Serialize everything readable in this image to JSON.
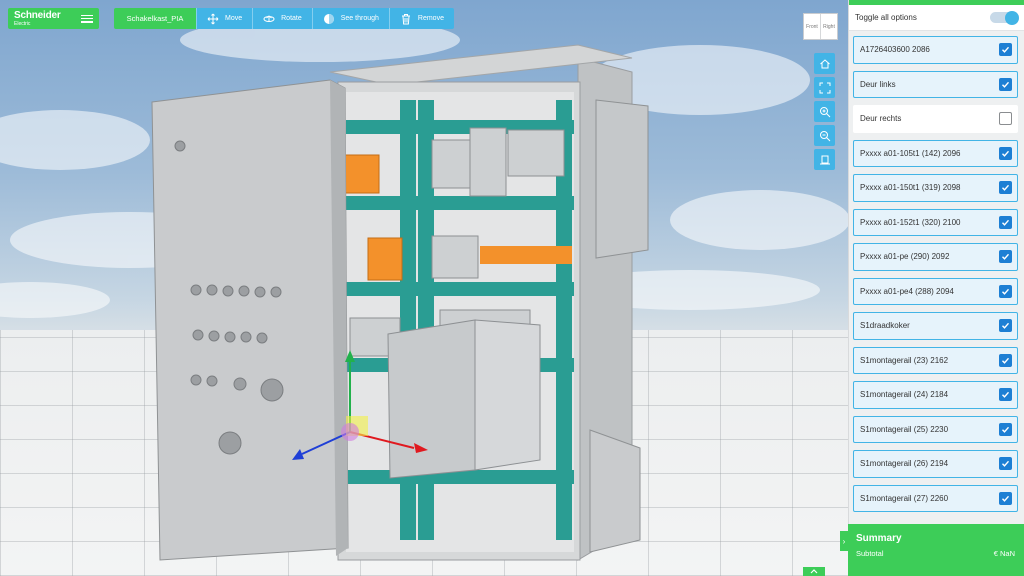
{
  "brand": {
    "name": "Schneider",
    "sub": "Electric"
  },
  "toolbar": {
    "project": "Schakelkast_PIA",
    "buttons": [
      {
        "label": "Move",
        "icon": "move-icon"
      },
      {
        "label": "Rotate",
        "icon": "rotate-icon"
      },
      {
        "label": "See through",
        "icon": "eye-icon"
      },
      {
        "label": "Remove",
        "icon": "trash-icon"
      }
    ]
  },
  "viewcube": {
    "left": "Front",
    "right": "Right"
  },
  "side_tools": [
    "home-icon",
    "fit-view-icon",
    "zoom-in-icon",
    "zoom-out-icon",
    "floor-view-icon"
  ],
  "panel": {
    "toggle_label": "Toggle all options",
    "toggle_on": true,
    "options": [
      {
        "label": "A1726403600 2086",
        "checked": true
      },
      {
        "label": "Deur links",
        "checked": true
      },
      {
        "label": "Deur rechts",
        "checked": false
      },
      {
        "label": "Pxxxx a01-105t1 (142) 2096",
        "checked": true
      },
      {
        "label": "Pxxxx a01-150t1 (319) 2098",
        "checked": true
      },
      {
        "label": "Pxxxx a01-152t1 (320) 2100",
        "checked": true
      },
      {
        "label": "Pxxxx a01-pe (290) 2092",
        "checked": true
      },
      {
        "label": "Pxxxx a01-pe4 (288) 2094",
        "checked": true
      },
      {
        "label": "S1draadkoker",
        "checked": true
      },
      {
        "label": "S1montagerail (23) 2162",
        "checked": true
      },
      {
        "label": "S1montagerail (24) 2184",
        "checked": true
      },
      {
        "label": "S1montagerail (25) 2230",
        "checked": true
      },
      {
        "label": "S1montagerail (26) 2194",
        "checked": true
      },
      {
        "label": "S1montagerail (27) 2260",
        "checked": true
      }
    ]
  },
  "summary": {
    "title": "Summary",
    "subtotal_label": "Subtotal",
    "subtotal_value": "€ NaN"
  },
  "colors": {
    "brand_green": "#3dcd58",
    "accent_blue": "#42b4e6",
    "checkbox_blue": "#1d7fd4",
    "rail_teal": "#2a9d93"
  }
}
